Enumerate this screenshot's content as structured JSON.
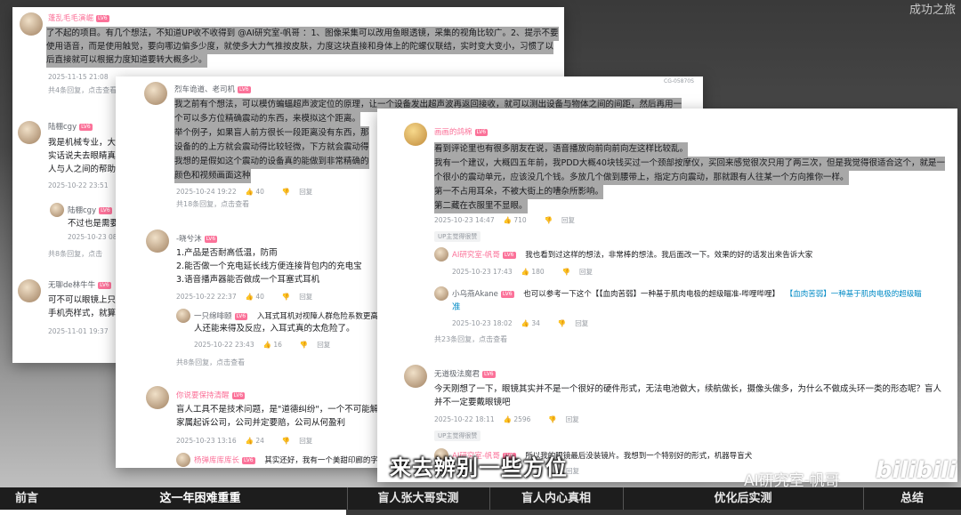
{
  "watermark_top": "成功之旅",
  "panel1": {
    "user": "蓬乱毛毛演崛",
    "text_lines": [
      "了不起的项目。有几个想法，不知道UP收不收得到 @AI研究室-帆哥 ：1、图像采集可以改用鱼眼透镜，采集的视角比较广。2、提示不要",
      "使用语音，而是使用触觉，要向哪边偏多少度，就使多大力气推按皮肤，力度这块直接和身体上的陀螺仪联结，实时变大变小，习惯了以",
      "后直接就可以根据力度知道要转大概多少。"
    ],
    "date": "2025-11-15 21:08",
    "extra": "共4条回复，点击查看",
    "c2_user": "陆棚cgy",
    "c2_lines": [
      "我是机械专业，大",
      "实话说夫去眼睛真",
      "人与人之间的帮助"
    ],
    "c2_date": "2025-10-22 23:51",
    "c3_user": "陆棚cgy",
    "c3_text": "不过也是需要",
    "c3_date": "2025-10-23 08:",
    "c3_extra": "共8条回复，点击",
    "c4_user": "无聊de林牛牛",
    "c4_lines": [
      "可不可以眼镜上只",
      "手机壳样式，就算"
    ],
    "c4_date": "2025-11-01 19:37"
  },
  "panel2": {
    "badge": "CG-05870S",
    "user": "烈车诡道、老司机",
    "text_lines": [
      "我之前有个想法，可以模仿蝙蝠超声波定位的原理，让一个设备发出超声波再返回接收，就可以测出设备与物体之间的间距，然后再用一",
      "个可以多方位精确震动的东西，来模拟这个距离。",
      "举个例子，如果盲人前方很长一段距离没有东西，那",
      "设备的的上方就会震动得比较轻微，下方就会震动得",
      "我想的是假如这个震动的设备真的能做到非常精确的",
      "颜色和视频画面这种"
    ],
    "date": "2025-10-24 19:22",
    "likes": "40",
    "extra": "共18条回复，点击查看",
    "c2_user": "-晓兮沐",
    "c2_lines": [
      "1.产品是否耐高低温，防雨",
      "2.能否做一个充电延长线方便连接背包内的充电宝",
      "3.语音播声器能否做成一个耳塞式耳机"
    ],
    "c2_date": "2025-10-22 22:37",
    "c2_likes": "40",
    "c3_user": "一只绵啡颐",
    "c3_text": "入耳式耳机对视障人群危险系数更高",
    "c3_text2": "人还能来得及反应，入耳式真的太危险了。",
    "c3_date": "2025-10-22 23:43",
    "c3_likes": "16",
    "c3_extra": "共8条回复，点击查看",
    "c4_user": "你说要保持清醒",
    "c4_lines": [
      "盲人工具不是技术问题，是\"道德纠纷\"，一个不可能解",
      "家属起诉公司，公司并定要赔，公司从何盈利"
    ],
    "c4_date": "2025-10-23 13:16",
    "c4_likes": "24",
    "c5_user": "杨弹库库库长",
    "c5_text": "其实还好，我有一个美甜印廊的字体"
  },
  "panel3": {
    "user": "画画的鸽棉",
    "text_lines": [
      "看到评论里也有很多朋友在说，语音播放向前向前向左这样比较乱。",
      "我有一个建议，大概四五年前，我PDD大概40块钱买过一个颈部按摩仪，买回来感觉很次只用了两三次，但是我觉得很适合这个，就是一",
      "个很小的震动单元，应该没几个钱。多放几个做到腰带上，指定方向震动，那就跟有人往某一个方向推你一样。",
      "第一不占用耳朵，不被大街上的嘈杂所影响。",
      "第二藏在衣服里不显眼。"
    ],
    "date": "2025-10-23 14:47",
    "likes": "710",
    "reply": "回复",
    "tag": "UP主觉得很赞",
    "r1_user": "AI研究室-帆哥",
    "r1_text": "我也看到过这样的想法，非常棒的想法。我后面改一下。效果的好的话发出来告诉大家",
    "r1_date": "2025-10-23 17:43",
    "r1_likes": "180",
    "r2_user": "小乌燕Akane",
    "r2_text": "也可以参考一下这个【【血肉苦弱】一种基于肌肉电极的超级瞄准-哔哩哔哩】",
    "r2_link": "【血肉苦弱】一种基于肌肉电极的超级瞄",
    "r2_text2": "准",
    "r2_date": "2025-10-23 18:02",
    "r2_likes": "34",
    "extra": "共23条回复，点击查看",
    "c2_user": "无道极法魔君",
    "c2_text": "今天刚想了一下，眼镜其实并不是一个很好的硬件形式，无法电池做大，续航做长，摄像头做多，为什么不做成头环一类的形态呢？盲人",
    "c2_text2": "并不一定要戴眼镜吧",
    "c2_date": "2025-10-22 18:11",
    "c2_likes": "2596",
    "c2_tag": "UP主觉得很赞",
    "c3_user": "AI研究室-帆哥",
    "c3_text": "所以我的眼镜最后没装镜片。我想到一个特别好的形式，机器导盲犬",
    "c3_reply": "回复"
  },
  "subtitle": "来去辨别一些方位",
  "brand": "AI研究室-帆哥",
  "bili": "bilibili",
  "chapters": [
    "前言",
    "这一年困难重重",
    "盲人张大哥实测",
    "盲人内心真相",
    "优化后实测",
    "总结"
  ],
  "progress_fraction": 0.36,
  "labels": {
    "reply": "回复",
    "lv": "LV6"
  },
  "colors": {
    "accent": "#fb7299",
    "link": "#008ac5"
  }
}
